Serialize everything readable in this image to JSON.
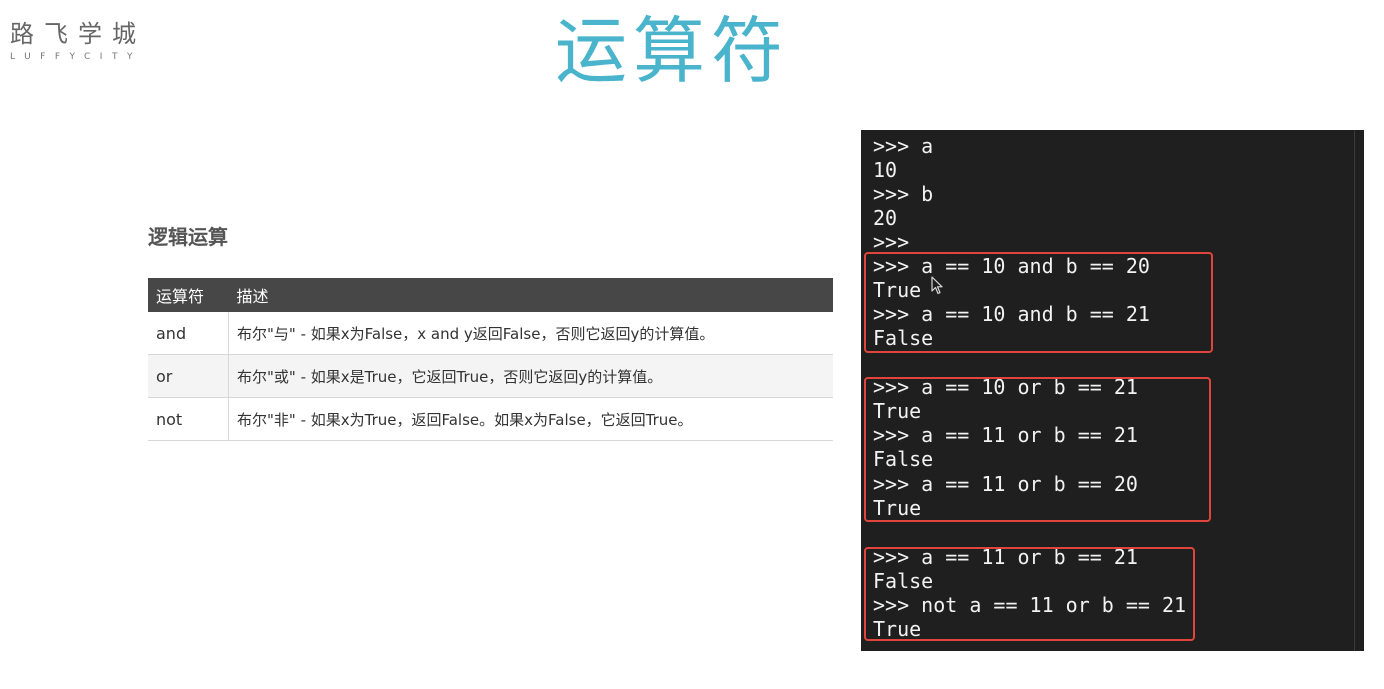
{
  "logo": {
    "cn": "路飞学城",
    "en": "LUFFYCITY"
  },
  "title": "运算符",
  "section": {
    "heading": "逻辑运算"
  },
  "table": {
    "headers": [
      "运算符",
      "描述"
    ],
    "rows": [
      {
        "op": "and",
        "desc": "布尔\"与\" - 如果x为False，x and y返回False，否则它返回y的计算值。"
      },
      {
        "op": "or",
        "desc": "布尔\"或\" - 如果x是True，它返回True，否则它返回y的计算值。"
      },
      {
        "op": "not",
        "desc": "布尔\"非\" - 如果x为True，返回False。如果x为False，它返回True。"
      }
    ]
  },
  "terminal": {
    "lines": [
      ">>> a",
      "10",
      ">>> b",
      "20",
      ">>>",
      ">>> a == 10 and b == 20",
      "True",
      ">>> a == 10 and b == 21",
      "False",
      ">>> a == 10 or b == 21",
      "True",
      ">>> a == 11 or b == 21",
      "False",
      ">>> a == 11 or b == 20",
      "True",
      ">>> a == 11 or b == 21",
      "False",
      ">>> not a == 11 or b == 21",
      "True"
    ]
  },
  "colors": {
    "title": "#49b4cc",
    "table_header_bg": "#474747",
    "terminal_bg": "#1f1f1f",
    "highlight_border": "#e0443a"
  },
  "icons": {
    "cursor": "mouse-pointer-icon"
  }
}
